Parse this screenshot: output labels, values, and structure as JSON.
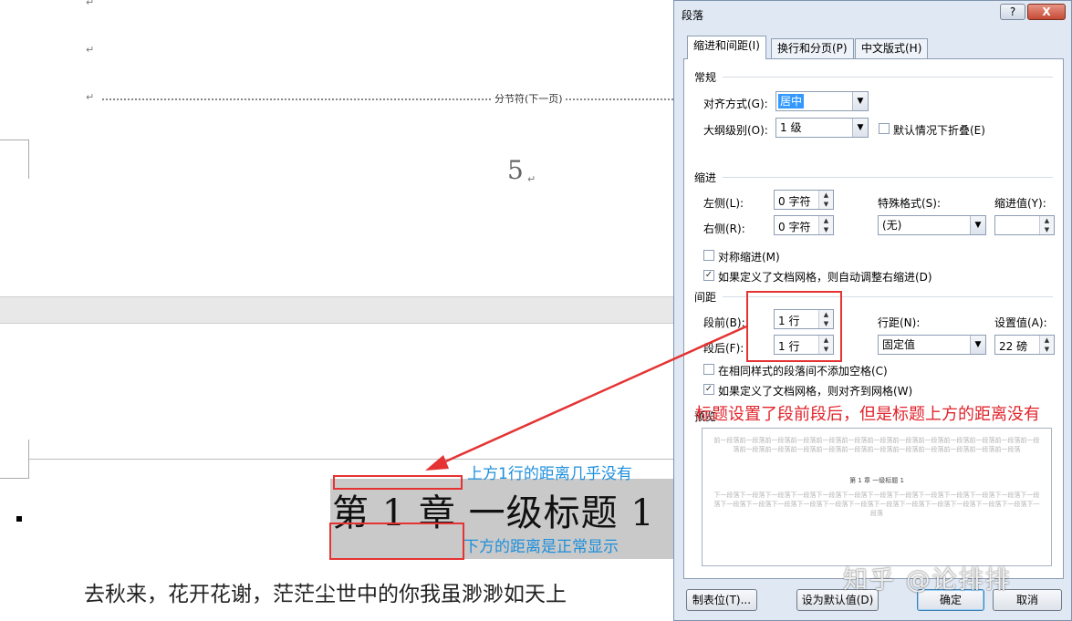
{
  "document": {
    "section_break_label": "分节符(下一页)",
    "page_number": "5",
    "paragraph_mark": "↵",
    "heading_text": "第 1 章  一级标题 1",
    "body_text": "去秋来，花开花谢，茫茫尘世中的你我虽渺渺如天上"
  },
  "annotations": {
    "above_note": "上方1行的距离几乎没有",
    "below_note": "下方的距离是正常显示",
    "dialog_note": "标题设置了段前段后，但是标题上方的距离没有"
  },
  "dialog": {
    "title": "段落",
    "help_label": "?",
    "close_label": "X",
    "tabs": [
      {
        "label": "缩进和间距(I)",
        "active": true
      },
      {
        "label": "换行和分页(P)",
        "active": false
      },
      {
        "label": "中文版式(H)",
        "active": false
      }
    ],
    "general": {
      "group_label": "常规",
      "alignment_label": "对齐方式(G):",
      "alignment_value": "居中",
      "outline_label": "大纲级别(O):",
      "outline_value": "1 级",
      "collapse_label": "默认情况下折叠(E)",
      "collapse_checked": false
    },
    "indent": {
      "group_label": "缩进",
      "left_label": "左侧(L):",
      "left_value": "0 字符",
      "right_label": "右侧(R):",
      "right_value": "0 字符",
      "special_label": "特殊格式(S):",
      "special_value": "(无)",
      "indent_by_label": "缩进值(Y):",
      "indent_by_value": "",
      "mirror_label": "对称缩进(M)",
      "mirror_checked": false,
      "auto_adjust_label": "如果定义了文档网格，则自动调整右缩进(D)",
      "auto_adjust_checked": true
    },
    "spacing": {
      "group_label": "间距",
      "before_label": "段前(B):",
      "before_value": "1 行",
      "after_label": "段后(F):",
      "after_value": "1 行",
      "line_spacing_label": "行距(N):",
      "line_spacing_value": "固定值",
      "at_label": "设置值(A):",
      "at_value": "22 磅",
      "no_space_label": "在相同样式的段落间不添加空格(C)",
      "no_space_checked": false,
      "snap_grid_label": "如果定义了文档网格，则对齐到网格(W)",
      "snap_grid_checked": true
    },
    "preview": {
      "group_label": "预览",
      "before_text": "前一段落前一段落前一段落前一段落前一段落前一段落前一段落前一段落前一段落前一段落前一段落前一段落前一段落前一段落前一段落前一段落前一段落前一段落前一段落前一段落前一段落前一段落前一段落前一段落",
      "sample_title": "第 1 章  一级标题 1",
      "after_text": "下一段落下一段落下一段落下一段落下一段落下一段落下一段落下一段落下一段落下一段落下一段落下一段落下一段落下一段落下一段落下一段落下一段落下一段落下一段落下一段落下一段落下一段落下一段落下一段落下一段落下一段落"
    },
    "buttons": {
      "tabs_label": "制表位(T)...",
      "default_label": "设为默认值(D)",
      "ok_label": "确定",
      "cancel_label": "取消"
    }
  },
  "watermark": "知乎 @论排排",
  "colors": {
    "annotation_blue": "#1e8fdc",
    "annotation_red": "#e0242c",
    "dialog_bg": "#dfe8f3",
    "selection": "#3399ff"
  }
}
